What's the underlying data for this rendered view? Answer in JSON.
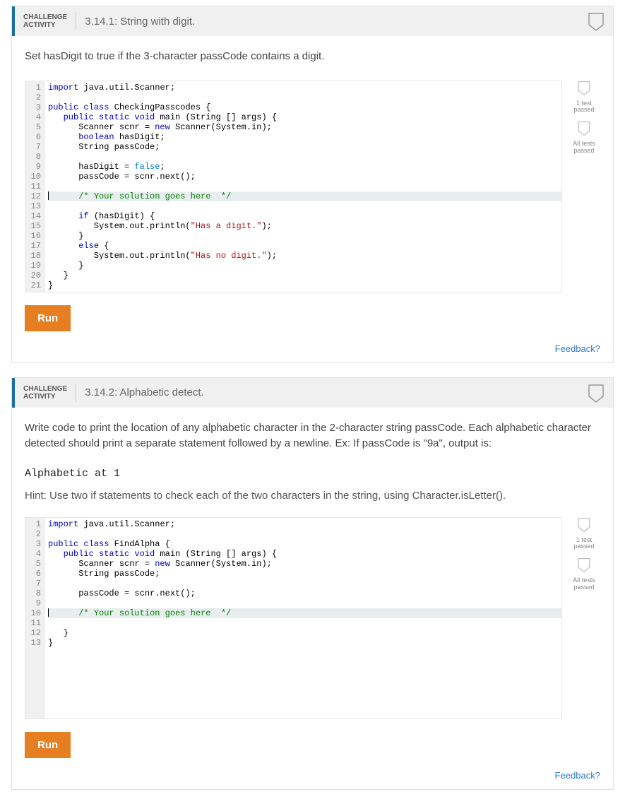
{
  "challenge_label": "CHALLENGE\nACTIVITY",
  "challenges": [
    {
      "title": "3.14.1: String with digit.",
      "prompt": "Set hasDigit to true if the 3-character passCode contains a digit.",
      "run_label": "Run",
      "feedback_label": "Feedback?",
      "badges": {
        "b1": "1 test\npassed",
        "b2": "All tests\npassed"
      },
      "code": {
        "highlight_line": 12,
        "lines": [
          {
            "n": "1",
            "t": [
              [
                "kw1",
                "import"
              ],
              [
                "",
                " java.util.Scanner;"
              ]
            ]
          },
          {
            "n": "2",
            "t": [
              [
                "",
                ""
              ]
            ]
          },
          {
            "n": "3",
            "t": [
              [
                "kw1",
                "public class"
              ],
              [
                "",
                " CheckingPasscodes {"
              ]
            ]
          },
          {
            "n": "4",
            "t": [
              [
                "",
                "   "
              ],
              [
                "kw1",
                "public static void"
              ],
              [
                "",
                " main (String [] args) {"
              ]
            ]
          },
          {
            "n": "5",
            "t": [
              [
                "",
                "      Scanner scnr = "
              ],
              [
                "kw1",
                "new"
              ],
              [
                "",
                " Scanner(System.in);"
              ]
            ]
          },
          {
            "n": "6",
            "t": [
              [
                "",
                "      "
              ],
              [
                "kw1",
                "boolean"
              ],
              [
                "",
                " hasDigit;"
              ]
            ]
          },
          {
            "n": "7",
            "t": [
              [
                "",
                "      String passCode;"
              ]
            ]
          },
          {
            "n": "8",
            "t": [
              [
                "",
                ""
              ]
            ]
          },
          {
            "n": "9",
            "t": [
              [
                "",
                "      hasDigit = "
              ],
              [
                "kw2",
                "false"
              ],
              [
                "",
                ";"
              ]
            ]
          },
          {
            "n": "10",
            "t": [
              [
                "",
                "      passCode = scnr.next();"
              ]
            ]
          },
          {
            "n": "11",
            "t": [
              [
                "",
                ""
              ]
            ]
          },
          {
            "n": "12",
            "t": [
              [
                "",
                "      "
              ],
              [
                "cmt",
                "/* Your solution goes here  */"
              ]
            ],
            "cursor": true
          },
          {
            "n": "13",
            "t": [
              [
                "",
                ""
              ]
            ]
          },
          {
            "n": "14",
            "t": [
              [
                "",
                "      "
              ],
              [
                "kw1",
                "if"
              ],
              [
                "",
                " (hasDigit) {"
              ]
            ]
          },
          {
            "n": "15",
            "t": [
              [
                "",
                "         System.out.println("
              ],
              [
                "str",
                "\"Has a digit.\""
              ],
              [
                "",
                ");"
              ]
            ]
          },
          {
            "n": "16",
            "t": [
              [
                "",
                "      }"
              ]
            ]
          },
          {
            "n": "17",
            "t": [
              [
                "",
                "      "
              ],
              [
                "kw1",
                "else"
              ],
              [
                "",
                " {"
              ]
            ]
          },
          {
            "n": "18",
            "t": [
              [
                "",
                "         System.out.println("
              ],
              [
                "str",
                "\"Has no digit.\""
              ],
              [
                "",
                ");"
              ]
            ]
          },
          {
            "n": "19",
            "t": [
              [
                "",
                "      }"
              ]
            ]
          },
          {
            "n": "20",
            "t": [
              [
                "",
                "   }"
              ]
            ]
          },
          {
            "n": "21",
            "t": [
              [
                "",
                "}"
              ]
            ]
          }
        ]
      }
    },
    {
      "title": "3.14.2: Alphabetic detect.",
      "prompt": "Write code to print the location of any alphabetic character in the 2-character string passCode. Each alphabetic character detected should print a separate statement followed by a newline. Ex: If passCode is \"9a\", output is:",
      "output": "Alphabetic at 1",
      "hint": "Hint: Use two if statements to check each of the two characters in the string, using Character.isLetter().",
      "run_label": "Run",
      "feedback_label": "Feedback?",
      "badges": {
        "b1": "1 test\npassed",
        "b2": "All tests\npassed"
      },
      "code": {
        "highlight_line": 10,
        "min_lines": 20,
        "lines": [
          {
            "n": "1",
            "t": [
              [
                "kw1",
                "import"
              ],
              [
                "",
                " java.util.Scanner;"
              ]
            ]
          },
          {
            "n": "2",
            "t": [
              [
                "",
                ""
              ]
            ]
          },
          {
            "n": "3",
            "t": [
              [
                "kw1",
                "public class"
              ],
              [
                "",
                " FindAlpha {"
              ]
            ]
          },
          {
            "n": "4",
            "t": [
              [
                "",
                "   "
              ],
              [
                "kw1",
                "public static void"
              ],
              [
                "",
                " main (String [] args) {"
              ]
            ]
          },
          {
            "n": "5",
            "t": [
              [
                "",
                "      Scanner scnr = "
              ],
              [
                "kw1",
                "new"
              ],
              [
                "",
                " Scanner(System.in);"
              ]
            ]
          },
          {
            "n": "6",
            "t": [
              [
                "",
                "      String passCode;"
              ]
            ]
          },
          {
            "n": "7",
            "t": [
              [
                "",
                ""
              ]
            ]
          },
          {
            "n": "8",
            "t": [
              [
                "",
                "      passCode = scnr.next();"
              ]
            ]
          },
          {
            "n": "9",
            "t": [
              [
                "",
                ""
              ]
            ]
          },
          {
            "n": "10",
            "t": [
              [
                "",
                "      "
              ],
              [
                "cmt",
                "/* Your solution goes here  */"
              ]
            ],
            "cursor": true
          },
          {
            "n": "11",
            "t": [
              [
                "",
                ""
              ]
            ]
          },
          {
            "n": "12",
            "t": [
              [
                "",
                "   }"
              ]
            ]
          },
          {
            "n": "13",
            "t": [
              [
                "",
                "}"
              ]
            ]
          }
        ]
      }
    }
  ]
}
